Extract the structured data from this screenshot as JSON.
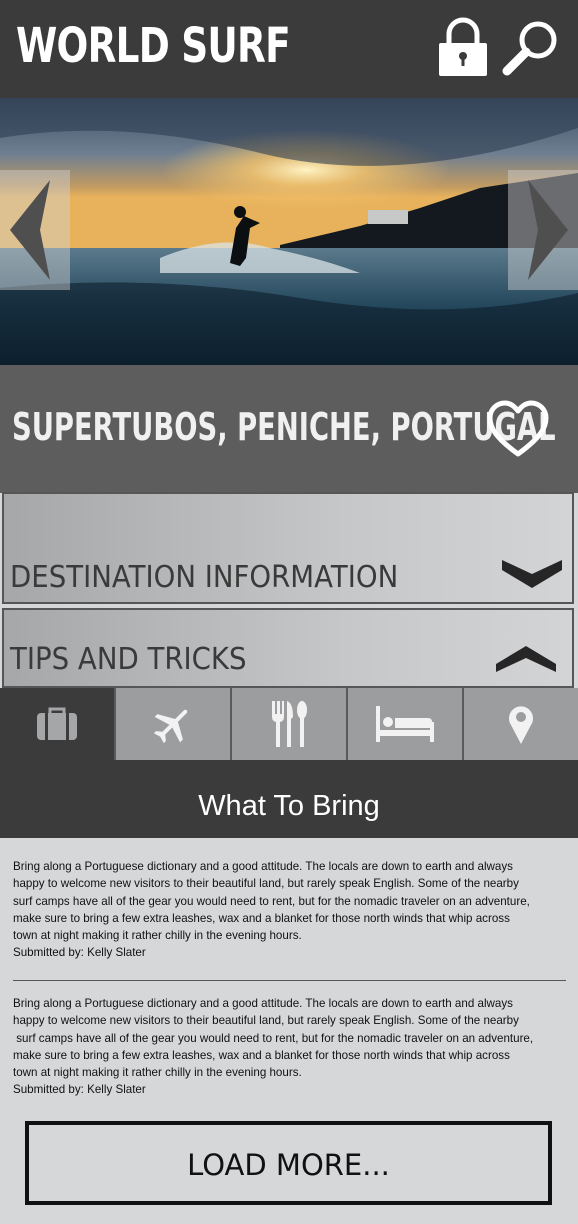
{
  "app": {
    "title": "WORLD SURF"
  },
  "header": {
    "lock_icon": "lock-icon",
    "search_icon": "search-icon"
  },
  "hero": {
    "image": "surfer-at-sunset-photo",
    "prev_icon": "chevron-left-icon",
    "next_icon": "chevron-right-icon"
  },
  "location": {
    "name": "SUPERTUBOS, PENICHE, PORTUGAL",
    "favorite_icon": "heart-icon"
  },
  "accordions": [
    {
      "label": "DESTINATION INFORMATION",
      "state": "collapsed",
      "icon": "chevron-down-icon"
    },
    {
      "label": "TIPS AND TRICKS",
      "state": "expanded",
      "icon": "chevron-up-icon"
    }
  ],
  "tabs": [
    {
      "icon": "suitcase-icon",
      "active": true
    },
    {
      "icon": "airplane-icon",
      "active": false
    },
    {
      "icon": "utensils-icon",
      "active": false
    },
    {
      "icon": "bed-icon",
      "active": false
    },
    {
      "icon": "map-pin-icon",
      "active": false
    }
  ],
  "section": {
    "title": "What To Bring"
  },
  "tips": [
    {
      "lines": [
        "Bring along a Portuguese dictionary and a good attitude. The locals are down to earth and always",
        "happy to welcome new visitors to their beautiful land, but rarely speak English. Some of the nearby",
        "surf camps have all of the gear you would need to rent, but for the nomadic traveler on an adventure,",
        "make sure to bring a few extra leashes, wax and a blanket for those north winds that whip across",
        "town at night making it rather chilly in the evening hours."
      ],
      "submitted_by": "Submitted by: Kelly Slater"
    },
    {
      "lines": [
        "Bring along a Portuguese dictionary and a good attitude. The locals are down to earth and always",
        "happy to welcome new visitors to their beautiful land, but rarely speak English. Some of the nearby",
        " surf camps have all of the gear you would need to rent, but for the nomadic traveler on an adventure,",
        "make sure to bring a few extra leashes, wax and a blanket for those north winds that whip across",
        "town at night making it rather chilly in the evening hours."
      ],
      "submitted_by": "Submitted by: Kelly Slater"
    }
  ],
  "load_more": {
    "label": "LOAD MORE..."
  },
  "colors": {
    "header_bg": "#3b3b3b",
    "band_bg": "#5d5d5d",
    "page_bg": "#d6d7d9",
    "tab_bg": "#9c9d9f"
  }
}
